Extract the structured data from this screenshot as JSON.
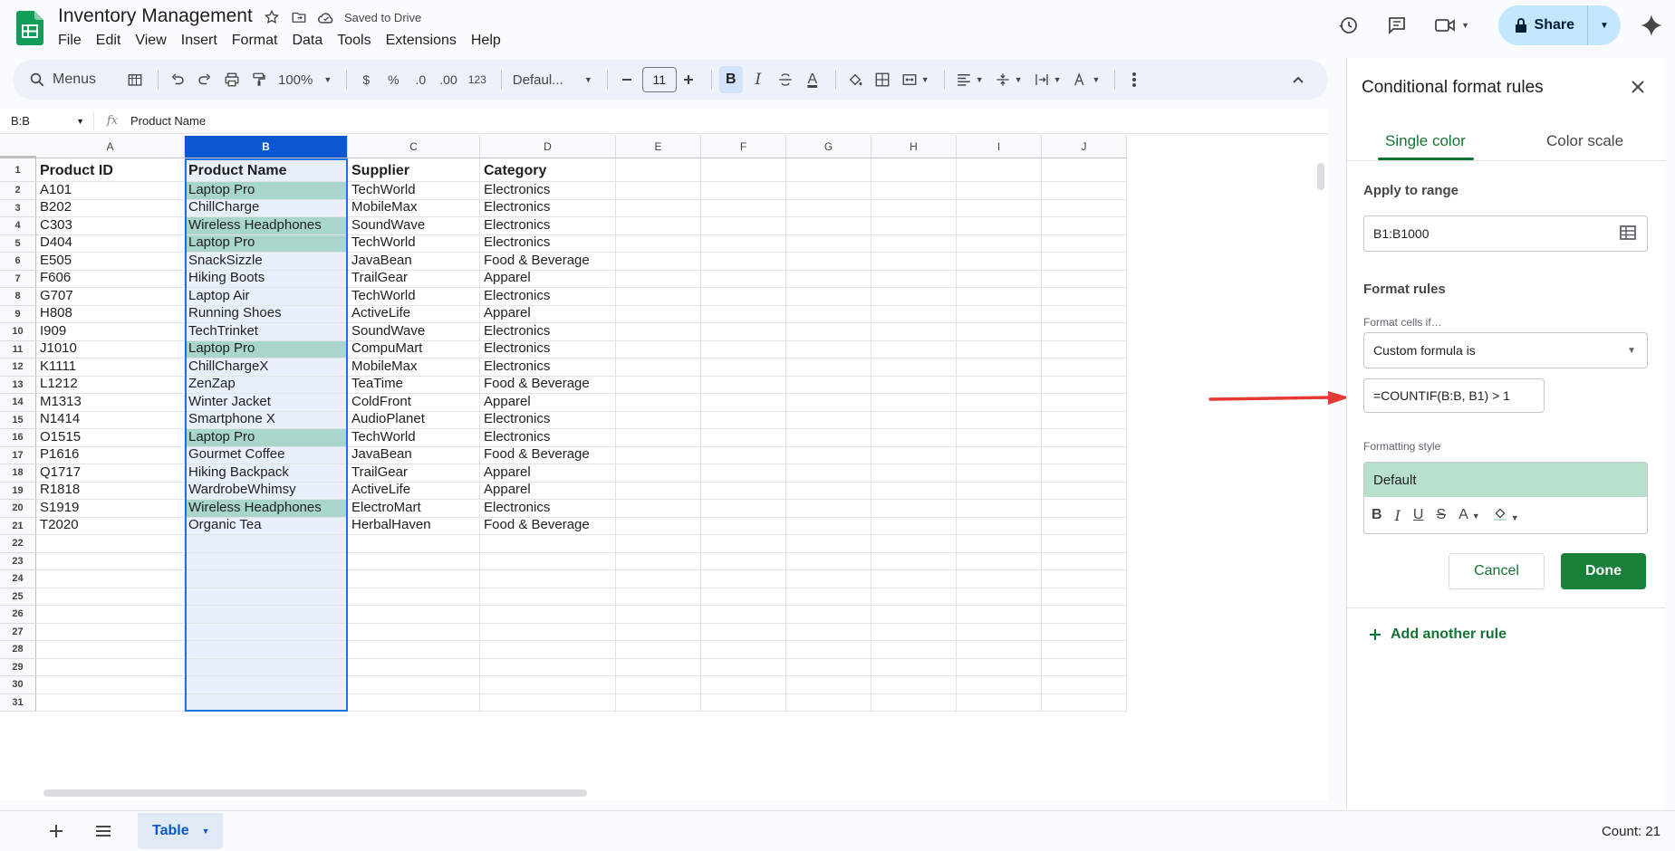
{
  "header": {
    "title": "Inventory Management",
    "saved_status": "Saved to Drive",
    "menu": [
      "File",
      "Edit",
      "View",
      "Insert",
      "Format",
      "Data",
      "Tools",
      "Extensions",
      "Help"
    ],
    "share_label": "Share",
    "accent_color": "#c2e7ff"
  },
  "toolbar": {
    "menus_label": "Menus",
    "zoom": "100%",
    "currency": "$",
    "percent": "%",
    "dec_decrease": ".0",
    "dec_increase": ".00",
    "number_format": "123",
    "font_name": "Defaul...",
    "font_size": "11",
    "bold": "B",
    "italic": "I",
    "text_color": "A",
    "icons": [
      "search-icon",
      "calendar-icon",
      "undo-icon",
      "redo-icon",
      "print-icon",
      "paint-format-icon",
      "minus-icon",
      "plus-icon",
      "strikethrough-icon",
      "fill-color-icon",
      "borders-icon",
      "merge-icon",
      "align-icon",
      "valign-icon",
      "wrap-icon",
      "rotate-icon",
      "more-icon",
      "collapse-icon"
    ]
  },
  "formula_bar": {
    "name_box": "B:B",
    "fx": "fx",
    "content": "Product Name"
  },
  "grid": {
    "columns": [
      "A",
      "B",
      "C",
      "D",
      "E",
      "F",
      "G",
      "H",
      "I",
      "J"
    ],
    "selected_column": "B",
    "row_numbers": [
      "1",
      "2",
      "3",
      "4",
      "5",
      "6",
      "7",
      "8",
      "9",
      "10",
      "11",
      "12",
      "13",
      "14",
      "15",
      "16",
      "17",
      "18",
      "19",
      "20",
      "21",
      "22",
      "23",
      "24",
      "25",
      "26",
      "27",
      "28",
      "29",
      "30",
      "31"
    ],
    "headers": [
      "Product ID",
      "Product Name",
      "Supplier",
      "Category"
    ],
    "rows": [
      [
        "A101",
        "Laptop Pro",
        "TechWorld",
        "Electronics"
      ],
      [
        "B202",
        "ChillCharge",
        "MobileMax",
        "Electronics"
      ],
      [
        "C303",
        "Wireless Headphones",
        "SoundWave",
        "Electronics"
      ],
      [
        "D404",
        "Laptop Pro",
        "TechWorld",
        "Electronics"
      ],
      [
        "E505",
        "SnackSizzle",
        "JavaBean",
        "Food & Beverage"
      ],
      [
        "F606",
        "Hiking Boots",
        "TrailGear",
        "Apparel"
      ],
      [
        "G707",
        "Laptop Air",
        "TechWorld",
        "Electronics"
      ],
      [
        "H808",
        "Running Shoes",
        "ActiveLife",
        "Apparel"
      ],
      [
        "I909",
        "TechTrinket",
        "SoundWave",
        "Electronics"
      ],
      [
        "J1010",
        "Laptop Pro",
        "CompuMart",
        "Electronics"
      ],
      [
        "K1111",
        "ChillChargeX",
        "MobileMax",
        "Electronics"
      ],
      [
        "L1212",
        "ZenZap",
        "TeaTime",
        "Food & Beverage"
      ],
      [
        "M1313",
        "Winter Jacket",
        "ColdFront",
        "Apparel"
      ],
      [
        "N1414",
        "Smartphone X",
        "AudioPlanet",
        "Electronics"
      ],
      [
        "O1515",
        "Laptop Pro",
        "TechWorld",
        "Electronics"
      ],
      [
        "P1616",
        "Gourmet Coffee",
        "JavaBean",
        "Food & Beverage"
      ],
      [
        "Q1717",
        "Hiking Backpack",
        "TrailGear",
        "Apparel"
      ],
      [
        "R1818",
        "WardrobeWhimsy",
        "ActiveLife",
        "Apparel"
      ],
      [
        "S1919",
        "Wireless Headphones",
        "ElectroMart",
        "Electronics"
      ],
      [
        "T2020",
        "Organic Tea",
        "HerbalHaven",
        "Food & Beverage"
      ]
    ],
    "highlight_color": "#a8d5cc",
    "selection_color": "#e8f0fe"
  },
  "bottom": {
    "sheet_name": "Table",
    "count": "Count: 21"
  },
  "panel": {
    "title": "Conditional format rules",
    "tab_single": "Single color",
    "tab_scale": "Color scale",
    "apply_label": "Apply to range",
    "range_value": "B1:B1000",
    "format_rules_label": "Format rules",
    "format_if_label": "Format cells if…",
    "condition": "Custom formula is",
    "formula": "=COUNTIF(B:B, B1) > 1",
    "style_label": "Formatting style",
    "style_preview": "Default",
    "cancel": "Cancel",
    "done": "Done",
    "add_rule": "Add another rule",
    "accent_color": "#188038"
  }
}
